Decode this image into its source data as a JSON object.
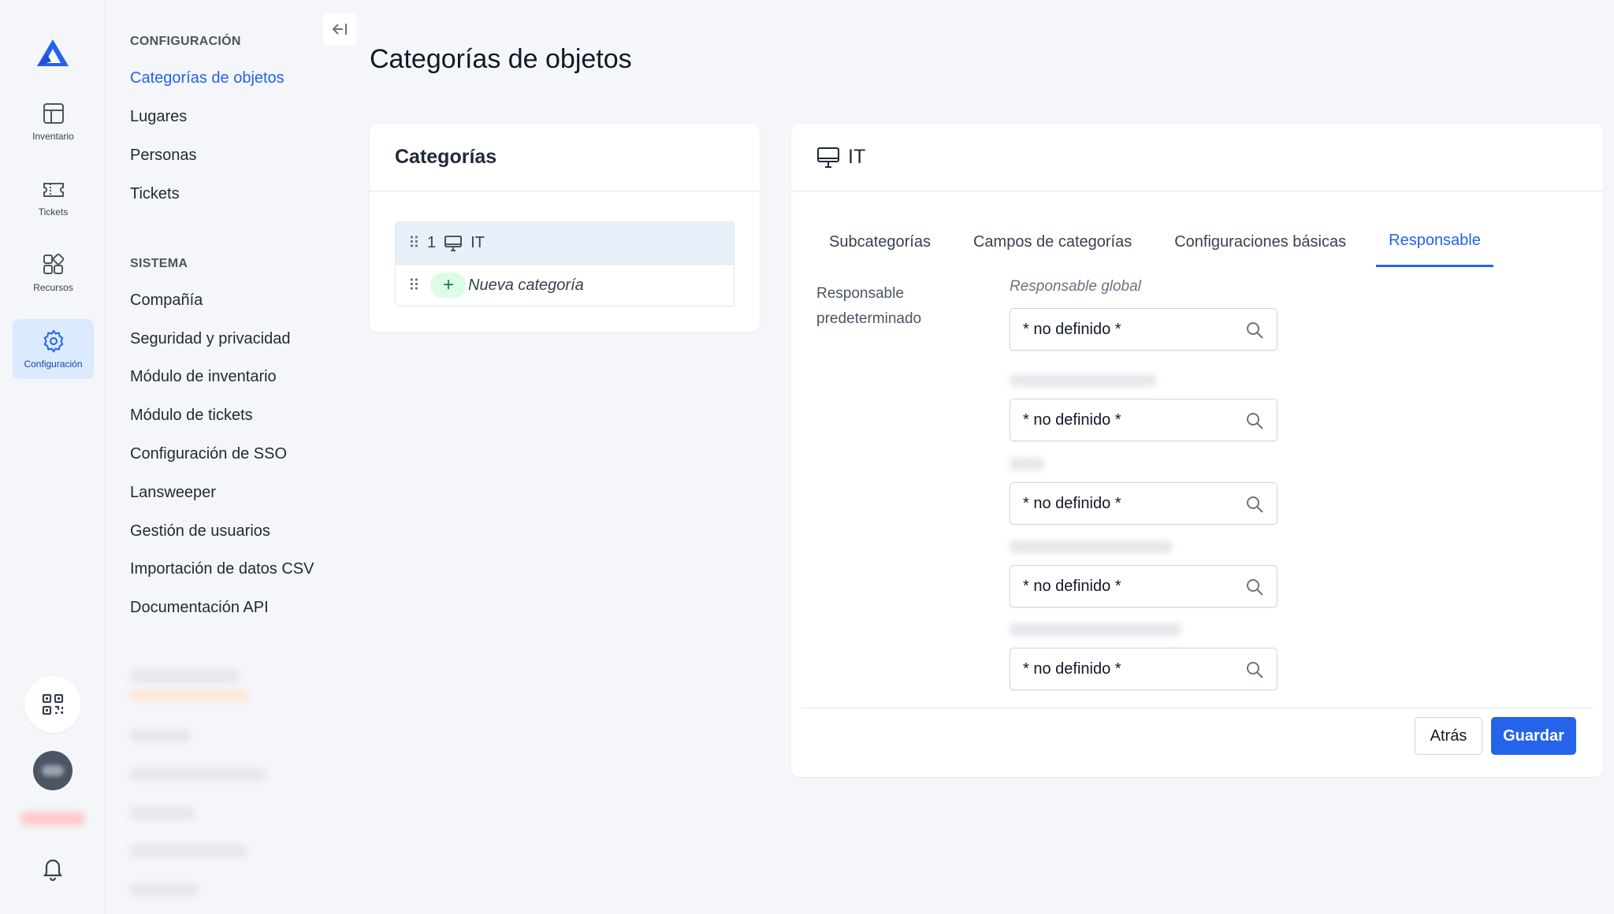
{
  "rail": {
    "items": [
      {
        "label": "Inventario",
        "icon": "table-icon"
      },
      {
        "label": "Tickets",
        "icon": "ticket-icon"
      },
      {
        "label": "Recursos",
        "icon": "resources-icon"
      },
      {
        "label": "Configuración",
        "icon": "gear-icon",
        "active": true
      }
    ],
    "bottom_icons": [
      "qr-code-icon",
      "user-avatar",
      "bell-icon"
    ]
  },
  "settings_nav": {
    "section1_title": "CONFIGURACIÓN",
    "section1_items": [
      "Categorías de objetos",
      "Lugares",
      "Personas",
      "Tickets"
    ],
    "section2_title": "SISTEMA",
    "section2_items": [
      "Compañía",
      "Seguridad y privacidad",
      "Módulo de inventario",
      "Módulo de tickets",
      "Configuración de SSO",
      "Lansweeper",
      "Gestión de usuarios",
      "Importación de datos CSV",
      "Documentación API"
    ],
    "active_item": "Categorías de objetos"
  },
  "page": {
    "title": "Categorías de objetos"
  },
  "categories_card": {
    "title": "Categorías",
    "rows": [
      {
        "number": "1",
        "icon": "monitor-icon",
        "name": "IT"
      }
    ],
    "new_label": "Nueva categoría"
  },
  "detail": {
    "title": "IT",
    "icon": "monitor-icon",
    "tabs": [
      "Subcategorías",
      "Campos de categorías",
      "Configuraciones básicas",
      "Responsable"
    ],
    "active_tab": "Responsable",
    "default_label": "Responsable predeterminado",
    "global_label": "Responsable global",
    "fields": [
      "* no definido *",
      "* no definido *",
      "* no definido *",
      "* no definido *",
      "* no definido *"
    ],
    "buttons": {
      "back": "Atrás",
      "save": "Guardar"
    }
  },
  "colors": {
    "accent": "#2563eb",
    "active_bg": "#dbeafe",
    "selected_row": "#e8f1f9",
    "add_green": "#dcfce7"
  }
}
